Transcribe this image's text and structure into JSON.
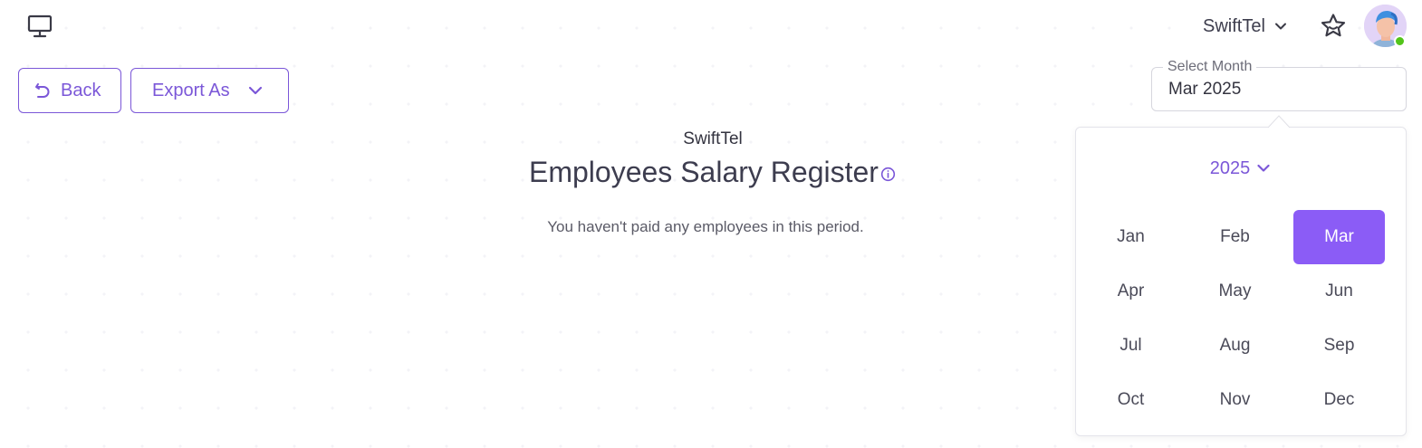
{
  "header": {
    "company_switcher": "SwiftTel",
    "icons": {
      "desktop": "desktop-monitor-icon",
      "chevron": "chevron-down-icon",
      "star": "star-icon",
      "avatar": "user-avatar",
      "status": "online-status"
    }
  },
  "toolbar": {
    "back_label": "Back",
    "export_label": "Export As"
  },
  "month_field": {
    "label": "Select Month",
    "value": "Mar 2025"
  },
  "report": {
    "company": "SwiftTel",
    "title": "Employees Salary Register",
    "empty_message": "You haven't paid any employees in this period."
  },
  "month_picker": {
    "year": "2025",
    "selected_month": "Mar",
    "months": [
      "Jan",
      "Feb",
      "Mar",
      "Apr",
      "May",
      "Jun",
      "Jul",
      "Aug",
      "Sep",
      "Oct",
      "Nov",
      "Dec"
    ]
  },
  "colors": {
    "accent": "#7b57d8",
    "selected_bg": "#8b5cf6",
    "online": "#52c41a"
  }
}
